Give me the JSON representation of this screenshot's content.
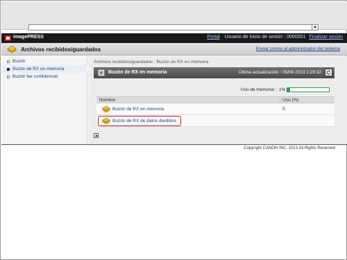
{
  "header": {
    "brand": "imagePRESS",
    "portal_link": "Portal",
    "user_text": "Usuario de inicio de sesión : 0000001",
    "logout_link": "Finalizar sesión"
  },
  "titlebar": {
    "title": "Archivos recibidos/guardados",
    "email_link": "Enviar correo al administrador del sistema"
  },
  "sidebar": {
    "items": [
      {
        "label": "Buzón"
      },
      {
        "label": "Buzón de RX en memoria"
      },
      {
        "label": "Buzón fax confidencial"
      }
    ]
  },
  "main": {
    "breadcrumb": "Archivos recibidos/guardados : Buzón de RX en memoria",
    "panel_title": "Buzón de RX en memoria",
    "last_update": "Última actualización : 05/08 2013 1:29:32",
    "memory_label": "Uso de memoria :",
    "memory_pct": "1%",
    "memory_value": 0.07,
    "table": {
      "headers": [
        "Nombre",
        "Uso (%)"
      ],
      "rows": [
        {
          "name": "Buzón de RX en memoria",
          "usage": "0"
        },
        {
          "name": "Buzón de RX de datos divididos",
          "usage": ""
        }
      ]
    }
  },
  "footer": {
    "copyright": "Copyright CANON INC. 2013 All Rights Reserved"
  },
  "colors": {
    "topbar": "#1a1a1a",
    "link": "#1a3c8a",
    "memory_bar": "#2e9a4f",
    "highlight": "#dd1111"
  }
}
